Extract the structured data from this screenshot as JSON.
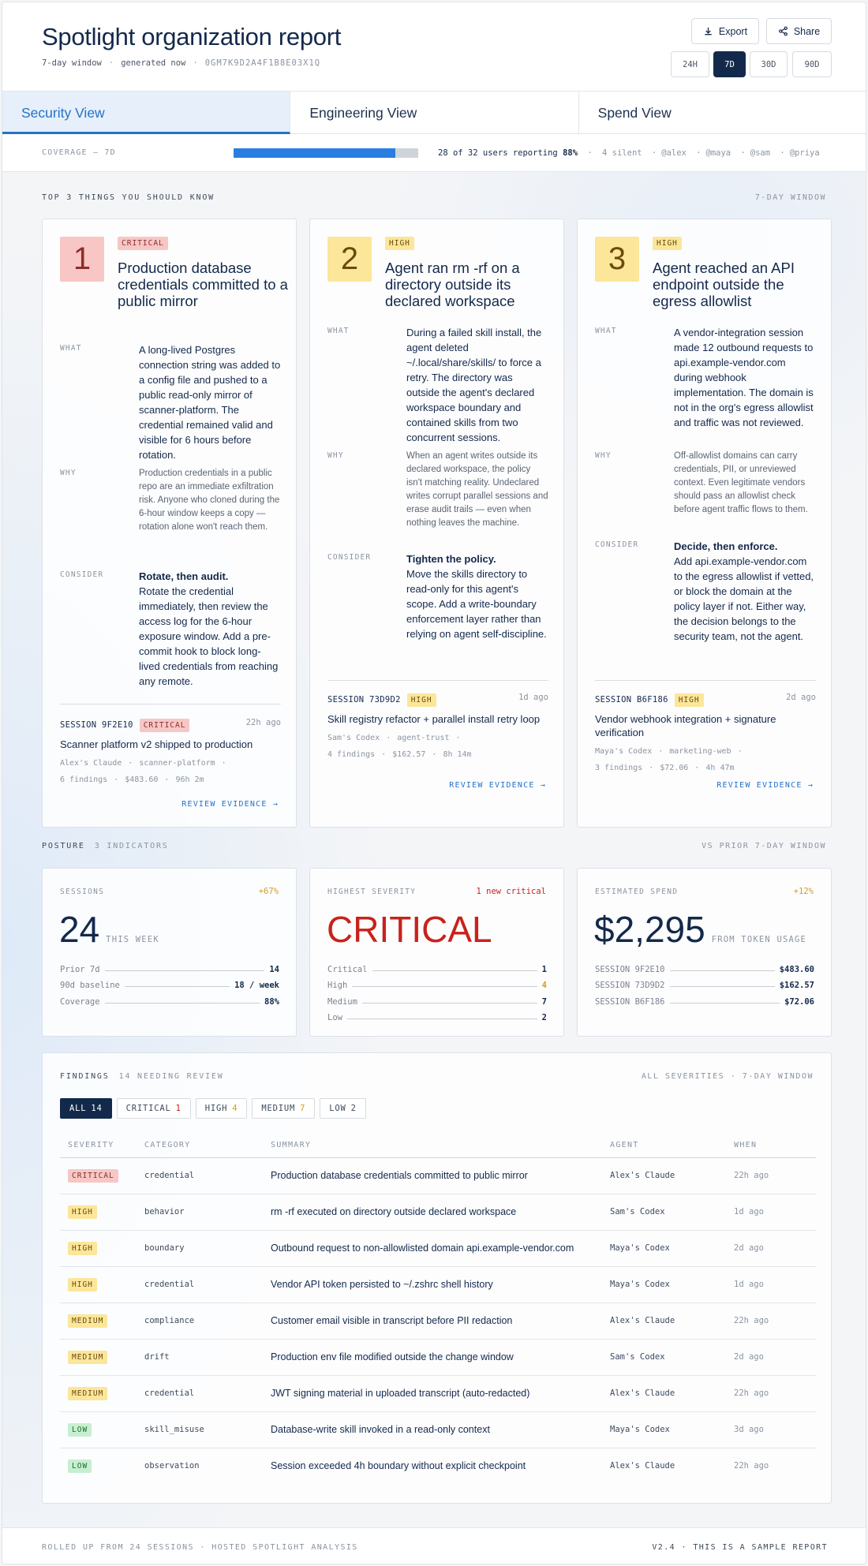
{
  "header": {
    "title": "Spotlight organization report",
    "window": "7-day window",
    "generated": "generated now",
    "report_id": "0GM7K9D2A4F1B8E03X1Q",
    "export_label": "Export",
    "share_label": "Share",
    "ranges": [
      "24H",
      "7D",
      "30D",
      "90D"
    ],
    "active_range": "7D"
  },
  "tabs": [
    {
      "label": "Security View",
      "active": true
    },
    {
      "label": "Engineering View",
      "active": false
    },
    {
      "label": "Spend View",
      "active": false
    }
  ],
  "coverage": {
    "label": "COVERAGE — 7D",
    "fraction": 0.875,
    "reporting": "28 of 32",
    "reporting_suffix": "users reporting",
    "percent": "88%",
    "silent": "4 silent",
    "users": [
      "@alex",
      "@maya",
      "@sam",
      "@priya"
    ]
  },
  "top3": {
    "heading": "TOP 3 THINGS YOU SHOULD KNOW",
    "window": "7-DAY WINDOW",
    "cards": [
      {
        "rank": "1",
        "severity": "CRITICAL",
        "title": "Production database credentials committed to a public mirror",
        "what": "A long-lived Postgres connection string was added to a config file and pushed to a public read-only mirror of scanner-platform. The credential remained valid and visible for 6 hours before rotation.",
        "why": "Production credentials in a public repo are an immediate exfiltration risk. Anyone who cloned during the 6-hour window keeps a copy — rotation alone won't reach them.",
        "consider_title": "Rotate, then audit.",
        "consider": "Rotate the credential immediately, then review the access log for the 6-hour exposure window. Add a pre-commit hook to block long-lived credentials from reaching any remote.",
        "session_id": "SESSION 9F2E10",
        "session_severity": "CRITICAL",
        "session_when": "22h ago",
        "session_title": "Scanner platform v2 shipped to production",
        "agent": "Alex's Claude",
        "project": "scanner-platform",
        "findings": "6 findings",
        "cost": "$483.60",
        "duration": "96h 2m",
        "review": "REVIEW EVIDENCE →"
      },
      {
        "rank": "2",
        "severity": "HIGH",
        "title": "Agent ran rm -rf on a directory outside its declared workspace",
        "what": "During a failed skill install, the agent deleted ~/.local/share/skills/ to force a retry. The directory was outside the agent's declared workspace boundary and contained skills from two concurrent sessions.",
        "why": "When an agent writes outside its declared workspace, the policy isn't matching reality. Undeclared writes corrupt parallel sessions and erase audit trails — even when nothing leaves the machine.",
        "consider_title": "Tighten the policy.",
        "consider": "Move the skills directory to read-only for this agent's scope. Add a write-boundary enforcement layer rather than relying on agent self-discipline.",
        "session_id": "SESSION 73D9D2",
        "session_severity": "HIGH",
        "session_when": "1d ago",
        "session_title": "Skill registry refactor + parallel install retry loop",
        "agent": "Sam's Codex",
        "project": "agent-trust",
        "findings": "4 findings",
        "cost": "$162.57",
        "duration": "8h 14m",
        "review": "REVIEW EVIDENCE →"
      },
      {
        "rank": "3",
        "severity": "HIGH",
        "title": "Agent reached an API endpoint outside the egress allowlist",
        "what": "A vendor-integration session made 12 outbound requests to api.example-vendor.com during webhook implementation. The domain is not in the org's egress allowlist and traffic was not reviewed.",
        "why": "Off-allowlist domains can carry credentials, PII, or unreviewed context. Even legitimate vendors should pass an allowlist check before agent traffic flows to them.",
        "consider_title": "Decide, then enforce.",
        "consider": "Add api.example-vendor.com to the egress allowlist if vetted, or block the domain at the policy layer if not. Either way, the decision belongs to the security team, not the agent.",
        "session_id": "SESSION B6F186",
        "session_severity": "HIGH",
        "session_when": "2d ago",
        "session_title": "Vendor webhook integration + signature verification",
        "agent": "Maya's Codex",
        "project": "marketing-web",
        "findings": "3 findings",
        "cost": "$72.06",
        "duration": "4h 47m",
        "review": "REVIEW EVIDENCE →"
      }
    ]
  },
  "labels": {
    "what": "WHAT",
    "why": "WHY",
    "consider": "CONSIDER"
  },
  "posture": {
    "heading": "POSTURE",
    "count": "3 INDICATORS",
    "compare": "VS PRIOR 7-DAY WINDOW",
    "sessions": {
      "label": "SESSIONS",
      "delta": "+67%",
      "value": "24",
      "unit": "THIS WEEK",
      "lines": [
        {
          "k": "Prior 7d",
          "v": "14"
        },
        {
          "k": "90d baseline",
          "v": "18 / week"
        },
        {
          "k": "Coverage",
          "v": "88%"
        }
      ]
    },
    "severity": {
      "label": "HIGHEST SEVERITY",
      "delta": "1 new critical",
      "value": "CRITICAL",
      "lines": [
        {
          "k": "Critical",
          "v": "1"
        },
        {
          "k": "High",
          "v": "4"
        },
        {
          "k": "Medium",
          "v": "7"
        },
        {
          "k": "Low",
          "v": "2"
        }
      ]
    },
    "spend": {
      "label": "ESTIMATED SPEND",
      "delta": "+12%",
      "value": "$2,295",
      "unit": "FROM TOKEN USAGE",
      "lines": [
        {
          "k": "SESSION 9F2E10",
          "v": "$483.60"
        },
        {
          "k": "SESSION 73D9D2",
          "v": "$162.57"
        },
        {
          "k": "SESSION B6F186",
          "v": "$72.06"
        }
      ]
    }
  },
  "findings": {
    "heading": "FINDINGS",
    "count": "14 NEEDING REVIEW",
    "scope": "ALL SEVERITIES · 7-DAY WINDOW",
    "filters": [
      {
        "label": "ALL",
        "n": "14"
      },
      {
        "label": "CRITICAL",
        "n": "1"
      },
      {
        "label": "HIGH",
        "n": "4"
      },
      {
        "label": "MEDIUM",
        "n": "7"
      },
      {
        "label": "LOW",
        "n": "2"
      }
    ],
    "columns": [
      "SEVERITY",
      "CATEGORY",
      "SUMMARY",
      "AGENT",
      "WHEN"
    ],
    "rows": [
      {
        "severity": "CRITICAL",
        "category": "credential",
        "summary": "Production database credentials committed to public mirror",
        "agent": "Alex's Claude",
        "when": "22h ago"
      },
      {
        "severity": "HIGH",
        "category": "behavior",
        "summary": "rm -rf executed on directory outside declared workspace",
        "agent": "Sam's Codex",
        "when": "1d ago"
      },
      {
        "severity": "HIGH",
        "category": "boundary",
        "summary": "Outbound request to non-allowlisted domain api.example-vendor.com",
        "agent": "Maya's Codex",
        "when": "2d ago"
      },
      {
        "severity": "HIGH",
        "category": "credential",
        "summary": "Vendor API token persisted to ~/.zshrc shell history",
        "agent": "Maya's Codex",
        "when": "1d ago"
      },
      {
        "severity": "MEDIUM",
        "category": "compliance",
        "summary": "Customer email visible in transcript before PII redaction",
        "agent": "Alex's Claude",
        "when": "22h ago"
      },
      {
        "severity": "MEDIUM",
        "category": "drift",
        "summary": "Production env file modified outside the change window",
        "agent": "Sam's Codex",
        "when": "2d ago"
      },
      {
        "severity": "MEDIUM",
        "category": "credential",
        "summary": "JWT signing material in uploaded transcript (auto-redacted)",
        "agent": "Alex's Claude",
        "when": "22h ago"
      },
      {
        "severity": "LOW",
        "category": "skill_misuse",
        "summary": "Database-write skill invoked in a read-only context",
        "agent": "Maya's Codex",
        "when": "3d ago"
      },
      {
        "severity": "LOW",
        "category": "observation",
        "summary": "Session exceeded 4h boundary without explicit checkpoint",
        "agent": "Alex's Claude",
        "when": "22h ago"
      }
    ]
  },
  "footer": {
    "left": "ROLLED UP FROM 24 SESSIONS · HOSTED SPOTLIGHT ANALYSIS",
    "right": "V2.4 · THIS IS A SAMPLE REPORT"
  },
  "colors": {
    "navy": "#13294b",
    "accent": "#2572c9",
    "critical": "#c9221b",
    "amber": "#d39e1a"
  }
}
